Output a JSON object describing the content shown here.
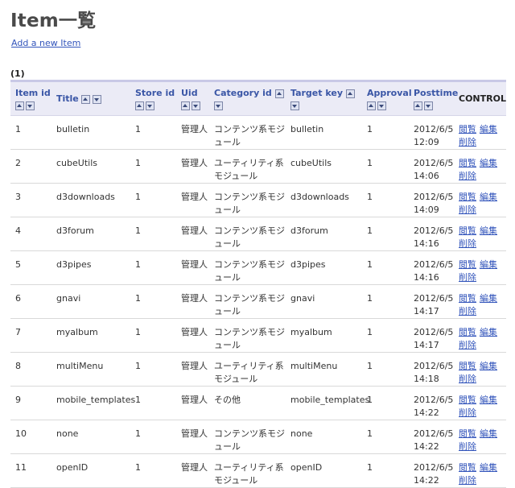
{
  "page": {
    "title": "Item一覧",
    "add_link": "Add a new Item",
    "count": "(1)"
  },
  "table": {
    "headers": {
      "item_id": "Item id",
      "title": "Title",
      "store_id": "Store id",
      "uid": "Uid",
      "category_id": "Category id",
      "target_key": "Target key",
      "approval": "Approval",
      "posttime": "Posttime",
      "control": "CONTROL"
    },
    "actions": {
      "view": "閲覧",
      "edit": "編集",
      "delete": "削除"
    },
    "sort_icons": {
      "ascending": "sort-ascending-icon",
      "descending": "sort-descending-icon"
    },
    "rows": [
      {
        "id": "1",
        "title": "bulletin",
        "store": "1",
        "uid": "管理人",
        "category": "コンテンツ系モジュール",
        "target": "bulletin",
        "approval": "1",
        "date": "2012/6/5",
        "time": "12:09"
      },
      {
        "id": "2",
        "title": "cubeUtils",
        "store": "1",
        "uid": "管理人",
        "category": "ユーティリティ系モジュール",
        "target": "cubeUtils",
        "approval": "1",
        "date": "2012/6/5",
        "time": "14:06"
      },
      {
        "id": "3",
        "title": "d3downloads",
        "store": "1",
        "uid": "管理人",
        "category": "コンテンツ系モジュール",
        "target": "d3downloads",
        "approval": "1",
        "date": "2012/6/5",
        "time": "14:09"
      },
      {
        "id": "4",
        "title": "d3forum",
        "store": "1",
        "uid": "管理人",
        "category": "コンテンツ系モジュール",
        "target": "d3forum",
        "approval": "1",
        "date": "2012/6/5",
        "time": "14:16"
      },
      {
        "id": "5",
        "title": "d3pipes",
        "store": "1",
        "uid": "管理人",
        "category": "コンテンツ系モジュール",
        "target": "d3pipes",
        "approval": "1",
        "date": "2012/6/5",
        "time": "14:16"
      },
      {
        "id": "6",
        "title": "gnavi",
        "store": "1",
        "uid": "管理人",
        "category": "コンテンツ系モジュール",
        "target": "gnavi",
        "approval": "1",
        "date": "2012/6/5",
        "time": "14:17"
      },
      {
        "id": "7",
        "title": "myalbum",
        "store": "1",
        "uid": "管理人",
        "category": "コンテンツ系モジュール",
        "target": "myalbum",
        "approval": "1",
        "date": "2012/6/5",
        "time": "14:17"
      },
      {
        "id": "8",
        "title": "multiMenu",
        "store": "1",
        "uid": "管理人",
        "category": "ユーティリティ系モジュール",
        "target": "multiMenu",
        "approval": "1",
        "date": "2012/6/5",
        "time": "14:18"
      },
      {
        "id": "9",
        "title": "mobile_templates",
        "store": "1",
        "uid": "管理人",
        "category": "その他",
        "target": "mobile_templates",
        "approval": "1",
        "date": "2012/6/5",
        "time": "14:22"
      },
      {
        "id": "10",
        "title": "none",
        "store": "1",
        "uid": "管理人",
        "category": "コンテンツ系モジュール",
        "target": "none",
        "approval": "1",
        "date": "2012/6/5",
        "time": "14:22"
      },
      {
        "id": "11",
        "title": "openID",
        "store": "1",
        "uid": "管理人",
        "category": "ユーティリティ系モジュール",
        "target": "openID",
        "approval": "1",
        "date": "2012/6/5",
        "time": "14:22"
      }
    ]
  },
  "colors": {
    "link": "#3355bb",
    "header_bg": "#ebebf6",
    "header_text": "#3a56a6"
  }
}
